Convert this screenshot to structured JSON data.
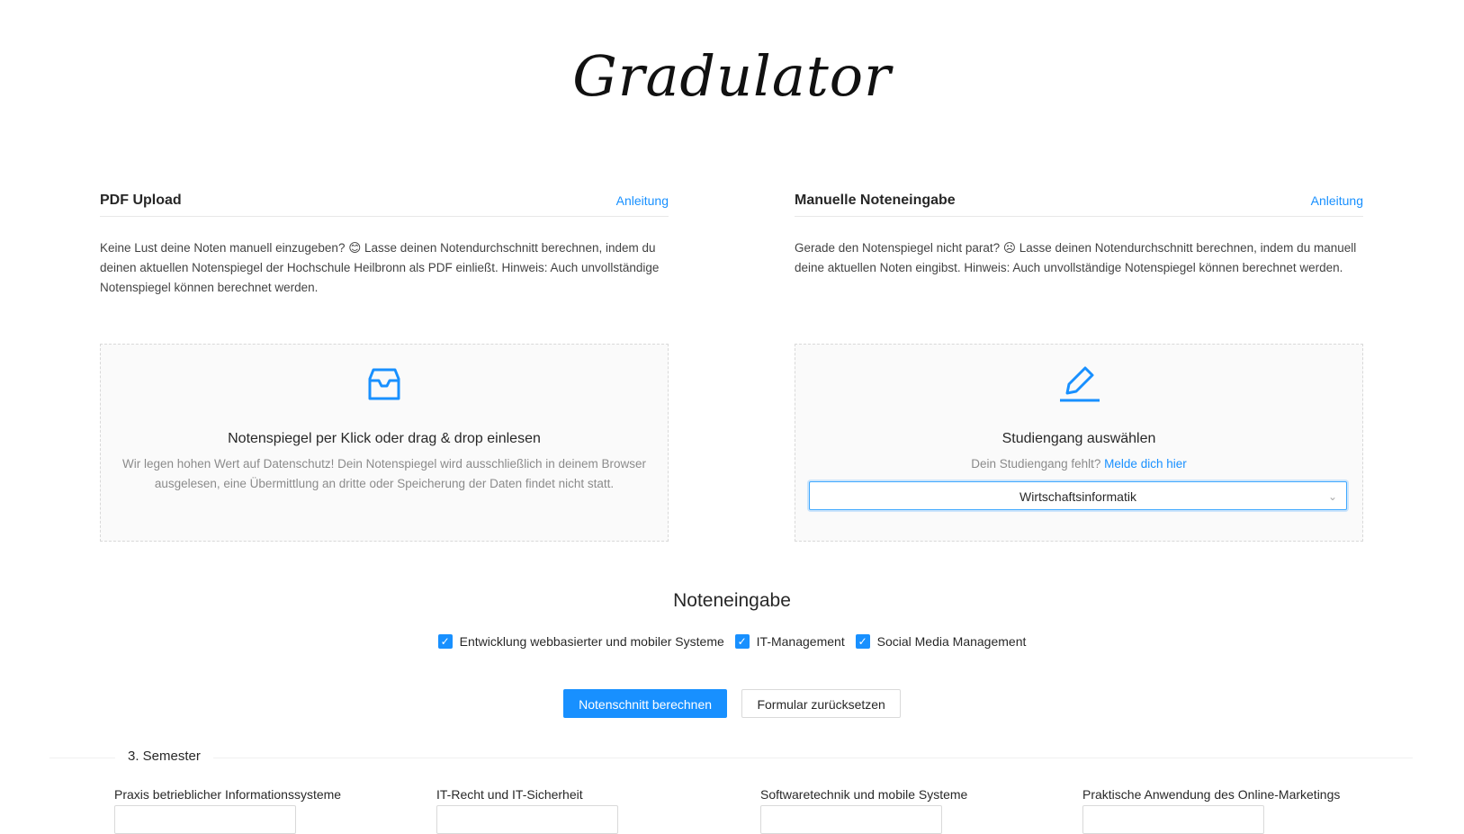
{
  "app": {
    "logo_text": "Gradulator"
  },
  "pdf_card": {
    "title": "PDF Upload",
    "link": "Anleitung",
    "description": "Keine Lust deine Noten manuell einzugeben? 😊 Lasse deinen Notendurchschnitt berechnen, indem du deinen aktuellen Notenspiegel der Hochschule Heilbronn als PDF einließt. Hinweis: Auch unvollständige Notenspiegel können berechnet werden.",
    "dropzone_title": "Notenspiegel per Klick oder drag & drop einlesen",
    "dropzone_hint": "Wir legen hohen Wert auf Datenschutz! Dein Notenspiegel wird ausschließlich in deinem Browser ausgelesen, eine Übermittlung an dritte oder Speicherung der Daten findet nicht statt.",
    "icon": "inbox-icon"
  },
  "manual_card": {
    "title": "Manuelle Noteneingabe",
    "link": "Anleitung",
    "description": "Gerade den Notenspiegel nicht parat? ☹ Lasse deinen Notendurchschnitt berechnen, indem du manuell deine aktuellen Noten eingibst. Hinweis: Auch unvollständige Notenspiegel können berechnet werden.",
    "dropzone_title": "Studiengang auswählen",
    "hint_text": "Dein Studiengang fehlt?",
    "hint_link": "Melde dich hier",
    "select_value": "Wirtschaftsinformatik",
    "icon": "edit-icon"
  },
  "grade_input": {
    "title": "Noteneingabe",
    "checkboxes": [
      {
        "label": "Entwicklung webbasierter und mobiler Systeme",
        "checked": true
      },
      {
        "label": "IT-Management",
        "checked": true
      },
      {
        "label": "Social Media Management",
        "checked": true
      }
    ],
    "primary_button": "Notenschnitt berechnen",
    "reset_button": "Formular zurücksetzen"
  },
  "semester": {
    "label": "3. Semester",
    "fields": [
      "Praxis betrieblicher Informationssysteme",
      "IT-Recht und IT-Sicherheit",
      "Softwaretechnik und mobile Systeme",
      "Praktische Anwendung des Online-Marketings"
    ]
  },
  "colors": {
    "accent": "#1890ff",
    "border": "#d9d9d9",
    "dropzone_bg": "#fafafa"
  }
}
